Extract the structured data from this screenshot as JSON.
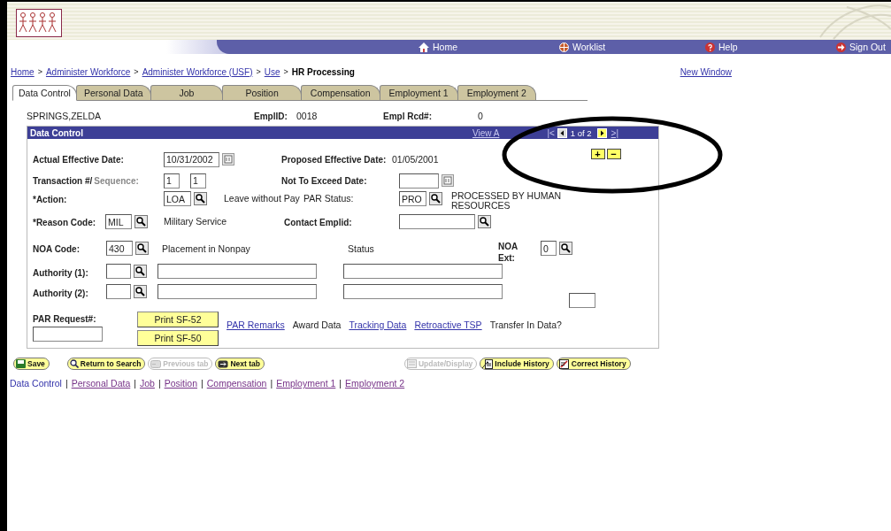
{
  "nav": [
    {
      "label": "Home"
    },
    {
      "label": "Worklist"
    },
    {
      "label": "Help"
    },
    {
      "label": "Sign Out"
    }
  ],
  "breadcrumb": [
    {
      "label": "Home",
      "kind": "link"
    },
    {
      "label": "Administer Workforce",
      "kind": "link"
    },
    {
      "label": "Administer Workforce (USF)",
      "kind": "link"
    },
    {
      "label": "Use",
      "kind": "link"
    },
    {
      "label": "HR Processing",
      "kind": "current"
    }
  ],
  "breadcrumb_separator": ">",
  "new_window": "New Window",
  "tabs": [
    {
      "label": "Data Control",
      "selected": true
    },
    {
      "label": "Personal Data",
      "selected": false
    },
    {
      "label": "Job",
      "selected": false
    },
    {
      "label": "Position",
      "selected": false
    },
    {
      "label": "Compensation",
      "selected": false
    },
    {
      "label": "Employment 1",
      "selected": false
    },
    {
      "label": "Employment 2",
      "selected": false
    }
  ],
  "employee": {
    "name": "SPRINGS,ZELDA",
    "emplid_label": "EmplID:",
    "emplid": "0018",
    "rcd_label": "Empl Rcd#:",
    "rcd": "0"
  },
  "panel": {
    "title": "Data Control",
    "view_all": "View A",
    "first": "|<",
    "position": "1 of 2",
    "last": ">|",
    "add": "+",
    "remove": "−"
  },
  "form": {
    "actual_effective_date": {
      "label": "Actual Effective Date:",
      "value": "10/31/2002"
    },
    "proposed_effective_date": {
      "label": "Proposed Effective Date:",
      "value": "01/05/2001"
    },
    "transaction": {
      "label": "Transaction #/",
      "sequence_label": "Sequence:",
      "value": "1",
      "sequence_value": "1"
    },
    "not_to_exceed_date": {
      "label": "Not To Exceed Date:"
    },
    "action": {
      "label": "*Action:",
      "value": "LOA",
      "description": "Leave without Pay"
    },
    "par_status": {
      "label": "PAR Status:",
      "value": "PRO",
      "description": "PROCESSED BY HUMAN RESOURCES"
    },
    "reason_code": {
      "label": "*Reason Code:",
      "value": "MIL",
      "description": "Military Service"
    },
    "contact_emplid": {
      "label": "Contact Emplid:"
    },
    "noa_code": {
      "label": "NOA Code:",
      "value": "430",
      "description": "Placement in Nonpay"
    },
    "status": {
      "label": "Status"
    },
    "noa_ext": {
      "label": "NOA Ext:",
      "value": "0"
    },
    "authorities": [
      {
        "label": "Authority (1):"
      },
      {
        "label": "Authority (2):"
      }
    ],
    "par_request": {
      "label": "PAR Request#:"
    },
    "print_buttons": [
      "Print SF-52",
      "Print SF-50"
    ],
    "links": [
      {
        "label": "PAR Remarks",
        "kind": "link"
      },
      {
        "label": "Award Data",
        "kind": "text"
      },
      {
        "label": "Tracking Data",
        "kind": "link"
      },
      {
        "label": "Retroactive TSP",
        "kind": "link"
      },
      {
        "label": "Transfer In Data?",
        "kind": "text"
      }
    ]
  },
  "toolbar_left": [
    {
      "label": "Save",
      "disabled": false
    },
    {
      "label": "Return to Search",
      "disabled": false
    },
    {
      "label": "Previous tab",
      "disabled": true
    },
    {
      "label": "Next tab",
      "disabled": false
    }
  ],
  "toolbar_right": [
    {
      "label": "Update/Display",
      "disabled": true
    },
    {
      "label": "Include History",
      "disabled": false
    },
    {
      "label": "Correct History",
      "disabled": false
    }
  ],
  "page_links": [
    {
      "label": "Data Control",
      "selected": true
    },
    {
      "label": "Personal Data",
      "selected": false
    },
    {
      "label": "Job",
      "selected": false
    },
    {
      "label": "Position",
      "selected": false
    },
    {
      "label": "Compensation",
      "selected": false
    },
    {
      "label": "Employment 1",
      "selected": false
    },
    {
      "label": "Employment 2",
      "selected": false
    }
  ],
  "page_link_separator": "|"
}
